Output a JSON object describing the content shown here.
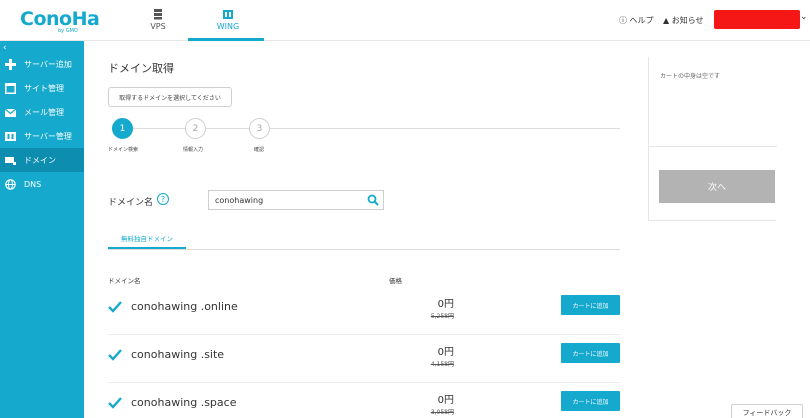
{
  "header": {
    "logo_text": "ConoHa",
    "logo_sub": "by GMO",
    "tabs": [
      {
        "label": "VPS",
        "icon": "server-icon"
      },
      {
        "label": "WING",
        "icon": "wing-icon",
        "active": true
      }
    ],
    "help_label": "ヘルプ",
    "notice_label": "お知らせ",
    "accent_color": "#14a9cd",
    "redacted_color": "#f51616"
  },
  "sidebar": {
    "items": [
      {
        "label": "サーバー追加",
        "icon": "plus-icon"
      },
      {
        "label": "サイト管理",
        "icon": "site-icon"
      },
      {
        "label": "メール管理",
        "icon": "mail-icon"
      },
      {
        "label": "サーバー管理",
        "icon": "server-icon"
      },
      {
        "label": "ドメイン",
        "icon": "domain-icon",
        "active": true
      },
      {
        "label": "DNS",
        "icon": "globe-icon"
      }
    ]
  },
  "main": {
    "title": "ドメイン取得",
    "hint": "取得するドメインを選択してください",
    "steps": [
      {
        "number": "1",
        "label": "ドメイン検索",
        "active": true
      },
      {
        "number": "2",
        "label": "情報入力"
      },
      {
        "number": "3",
        "label": "確認"
      }
    ],
    "domain_label": "ドメイン名",
    "help_mark": "?",
    "search_value": "conohawing",
    "tab_label": "無料独自ドメイン",
    "columns": {
      "name": "ドメイン名",
      "price": "価格"
    },
    "rows": [
      {
        "name": "conohawing .online",
        "price": "0円",
        "old_price": "5,258円",
        "button": "カートに追加"
      },
      {
        "name": "conohawing .site",
        "price": "0円",
        "old_price": "4,158円",
        "button": "カートに追加"
      },
      {
        "name": "conohawing .space",
        "price": "0円",
        "old_price": "3,058円",
        "button": "カートに追加"
      }
    ]
  },
  "cart": {
    "empty_text": "カートの中身は空です",
    "next_label": "次へ"
  },
  "feedback_label": "フィードバック"
}
